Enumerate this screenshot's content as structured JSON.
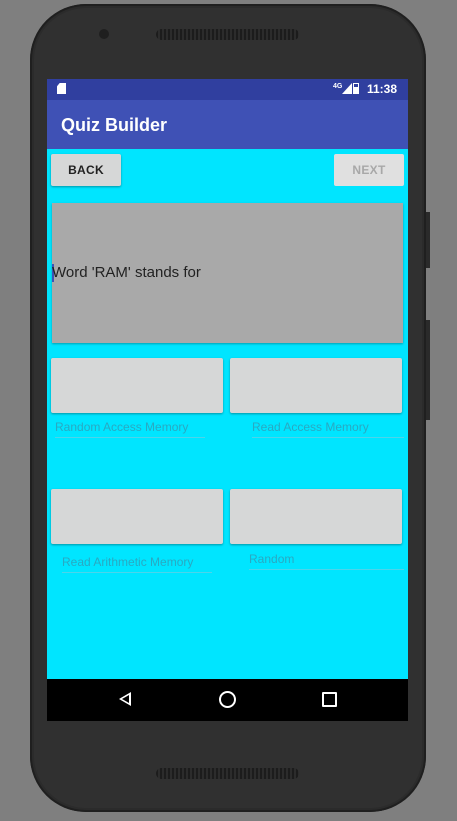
{
  "status_bar": {
    "network_label": "4G",
    "time": "11:38"
  },
  "app_bar": {
    "title": "Quiz Builder"
  },
  "buttons": {
    "back_label": "BACK",
    "next_label": "NEXT"
  },
  "question": {
    "text": "Word 'RAM' stands for"
  },
  "answers": [
    {
      "label": "Random Access Memory"
    },
    {
      "label": "Read Access Memory"
    },
    {
      "label": "Read Arithmetic Memory"
    },
    {
      "label": "Random"
    }
  ],
  "colors": {
    "background": "#00e5ff",
    "app_bar": "#3f51b5",
    "status_bar": "#303f9f",
    "answer_hint": "#29a9c2"
  },
  "icons": {
    "status": [
      "sd-card-icon",
      "signal-icon",
      "battery-icon"
    ],
    "nav": [
      "nav-back-icon",
      "nav-home-icon",
      "nav-recents-icon"
    ]
  }
}
